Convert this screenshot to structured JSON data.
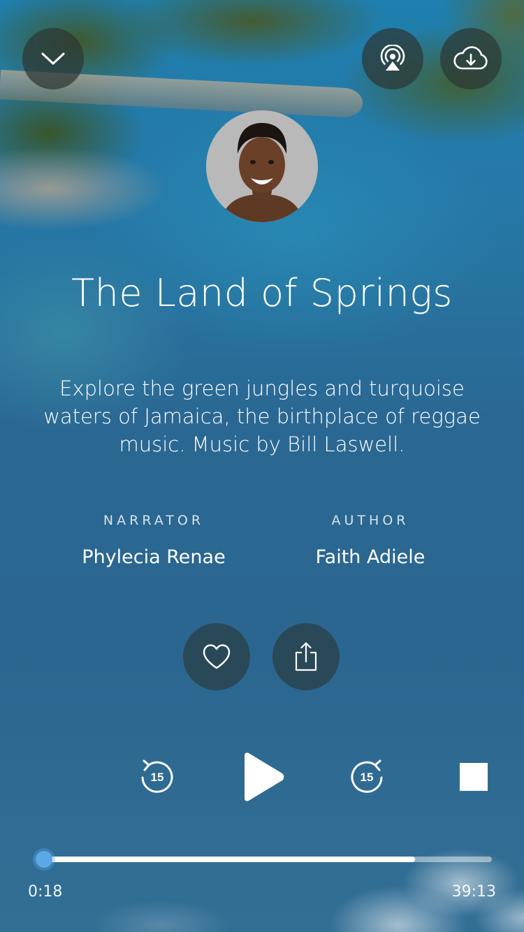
{
  "header": {
    "close_icon": "chevron-down-icon",
    "airplay_icon": "airplay-icon",
    "download_icon": "cloud-download-icon"
  },
  "track": {
    "title": "The Land of Springs",
    "description": "Explore the green jungles and turquoise waters of Jamaica, the birthplace of reggae music. Music by Bill Laswell."
  },
  "credits": {
    "narrator_label": "NARRATOR",
    "narrator_name": "Phylecia Renae",
    "author_label": "AUTHOR",
    "author_name": "Faith Adiele"
  },
  "actions": {
    "like_icon": "heart-outline-icon",
    "share_icon": "share-icon"
  },
  "controls": {
    "rewind_seconds": "15",
    "forward_seconds": "15",
    "play_icon": "play-icon",
    "stop_icon": "stop-icon"
  },
  "playback": {
    "elapsed": "0:18",
    "total": "39:13",
    "progress_fraction": 0.008,
    "buffered_fraction": 0.83
  },
  "colors": {
    "accent_thumb": "#5aa8e8",
    "button_bg": "#2c3834"
  }
}
